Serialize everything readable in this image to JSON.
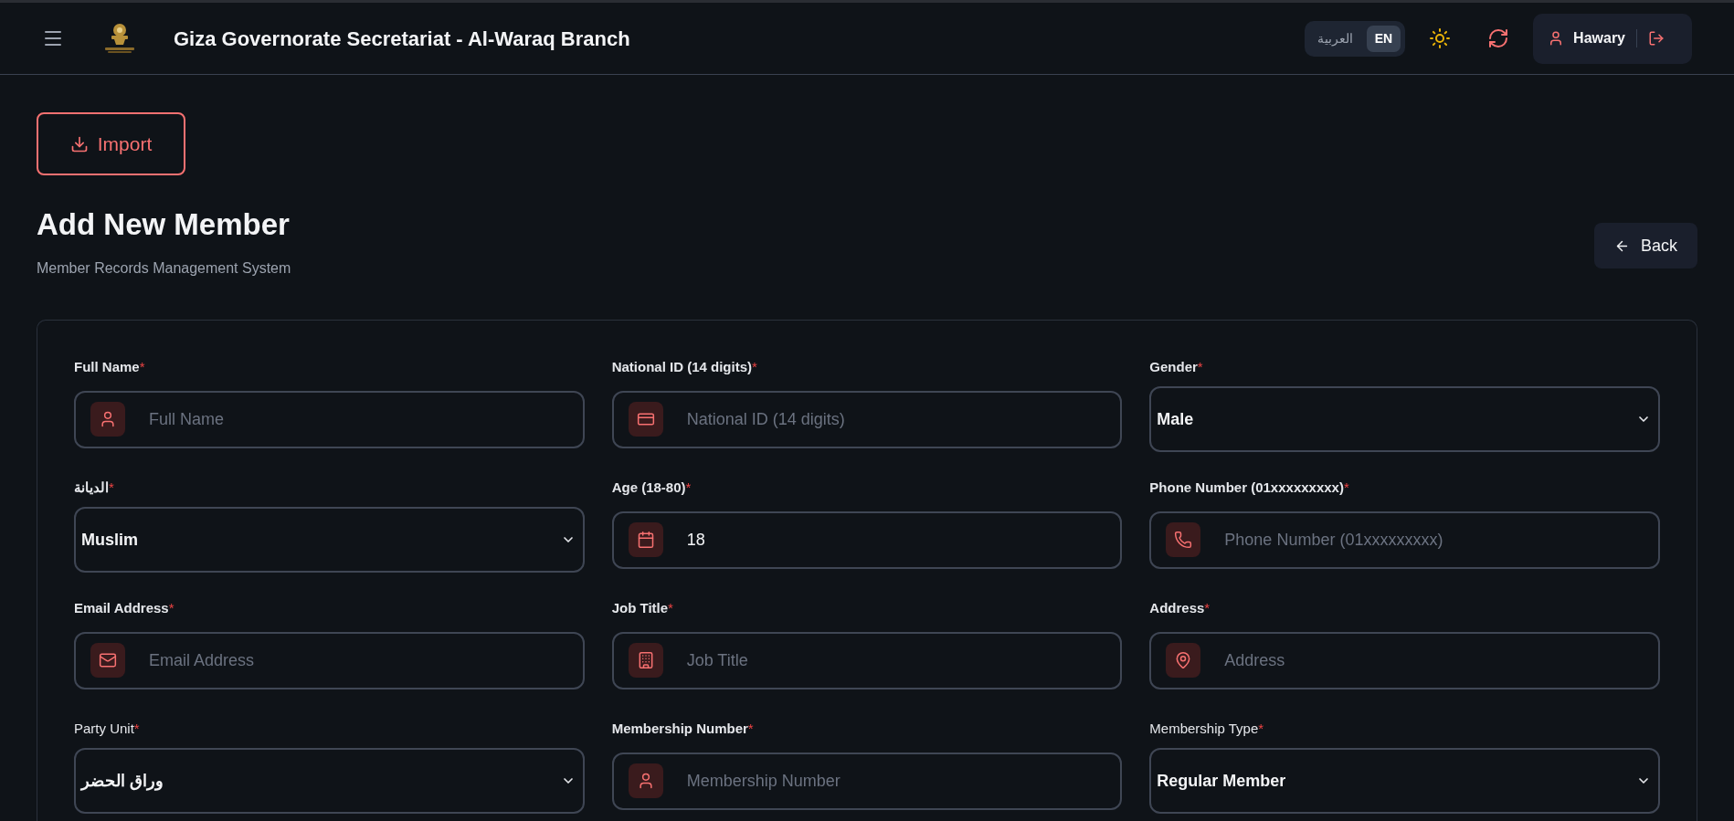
{
  "header": {
    "title": "Giza Governorate Secretariat - Al-Waraq Branch",
    "languages": [
      {
        "label": "العربية",
        "selected": false
      },
      {
        "label": "EN",
        "selected": true
      }
    ],
    "user": "Hawary"
  },
  "import_button": "Import",
  "page": {
    "title": "Add New Member",
    "subtitle": "Member Records Management System",
    "back_button": "Back"
  },
  "fields": [
    {
      "kind": "input",
      "label": "Full Name",
      "mark": "*",
      "placeholder": "Full Name"
    },
    {
      "kind": "input",
      "label": "National ID (14 digits)",
      "mark": "*",
      "placeholder": "National ID (14 digits)"
    },
    {
      "kind": "select",
      "label": "Gender",
      "mark": "*",
      "value": "Male"
    },
    {
      "kind": "select",
      "label": "الديانة",
      "mark": "*",
      "value": "Muslim"
    },
    {
      "kind": "input",
      "label": "Age (18-80)",
      "mark": "*",
      "value": "18"
    },
    {
      "kind": "input",
      "label": "Phone Number (01xxxxxxxxx)",
      "mark": "*",
      "placeholder": "Phone Number (01xxxxxxxxx)"
    },
    {
      "kind": "input",
      "label": "Email Address",
      "mark": "*",
      "placeholder": "Email Address"
    },
    {
      "kind": "input",
      "label": "Job Title",
      "mark": "*",
      "placeholder": "Job Title"
    },
    {
      "kind": "input",
      "label": "Address",
      "mark": "*",
      "placeholder": "Address"
    },
    {
      "kind": "select",
      "label": "Party Unit",
      "mark": "*",
      "value": "وراق الحضر"
    },
    {
      "kind": "input",
      "label": "Membership Number",
      "mark": "*",
      "placeholder": "Membership Number"
    },
    {
      "kind": "select",
      "label": "Membership Type",
      "mark": "*",
      "value": "Regular Member"
    }
  ]
}
